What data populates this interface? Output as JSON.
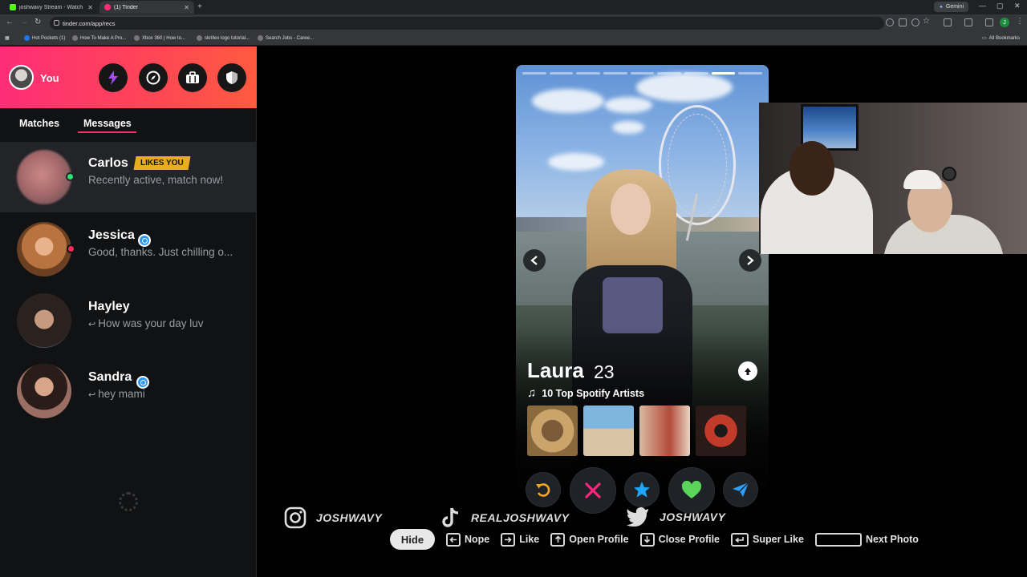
{
  "browser": {
    "tabs": [
      {
        "title": "joshwavy Stream - Watch Live o",
        "fav_color": "#53fc18"
      },
      {
        "title": "(1) Tinder",
        "fav_color": "#fd2d77"
      }
    ],
    "gemini_label": "Gemini",
    "url": "tinder.com/app/recs",
    "profile_letter": "J",
    "bookmarks": [
      "Hot Pockets (1)",
      "How To Make A Pro...",
      "Xbox 360 | How to...",
      "skrillex logo tutorial...",
      "Search Jobs - Caree..."
    ],
    "all_bookmarks": "All Bookmarks"
  },
  "sidebar": {
    "me": "You",
    "tabs": {
      "matches": "Matches",
      "messages": "Messages"
    },
    "conversations": [
      {
        "name": "Carlos",
        "badge": "LIKES YOU",
        "message": "Recently active, match now!",
        "status_color": "#2ce271"
      },
      {
        "name": "Jessica",
        "message": "Good, thanks. Just chilling o...",
        "status_color": "#fd2d55"
      },
      {
        "name": "Hayley",
        "message": "How was your day luv"
      },
      {
        "name": "Sandra",
        "message": "hey mami"
      }
    ]
  },
  "profile": {
    "name": "Laura",
    "age": "23",
    "spotify_label": "10 Top Spotify Artists",
    "photo_count": 9,
    "active_photo": 8
  },
  "actions": [
    "rewind",
    "nope",
    "super-like",
    "like",
    "boost"
  ],
  "colors": {
    "rewind": "#f5a623",
    "nope": "#fd267d",
    "super_like": "#1fa7ff",
    "like": "#5bd45b",
    "boost": "#29a2ff"
  },
  "socials": {
    "instagram": "JOSHWAVY",
    "tiktok": "REALJOSHWAVY",
    "twitter": "JOSHWAVY"
  },
  "shortcuts": {
    "hide": "Hide",
    "nope": "Nope",
    "like": "Like",
    "open_profile": "Open Profile",
    "close_profile": "Close Profile",
    "super_like": "Super Like",
    "next_photo": "Next Photo"
  }
}
